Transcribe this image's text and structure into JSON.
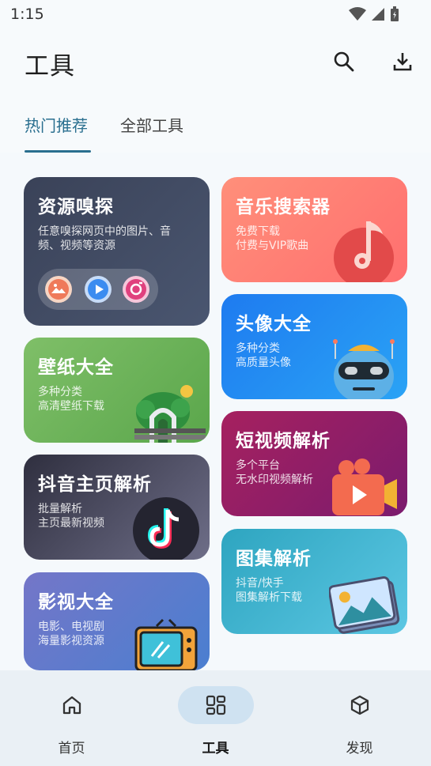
{
  "status": {
    "time": "1:15"
  },
  "header": {
    "title": "工具"
  },
  "tabs": [
    {
      "label": "热门推荐"
    },
    {
      "label": "全部工具"
    }
  ],
  "cards": {
    "sniff": {
      "title": "资源嗅探",
      "desc": [
        "任意嗅探网页中的图片、音",
        "频、视频等资源"
      ]
    },
    "music": {
      "title": "音乐搜索器",
      "desc": [
        "免费下载",
        "付费与VIP歌曲"
      ]
    },
    "avatar": {
      "title": "头像大全",
      "desc": [
        "多种分类",
        "高质量头像"
      ]
    },
    "wallpaper": {
      "title": "壁纸大全",
      "desc": [
        "多种分类",
        "高清壁纸下载"
      ]
    },
    "shortvideo": {
      "title": "短视频解析",
      "desc": [
        "多个平台",
        "无水印视频解析"
      ]
    },
    "douyin": {
      "title": "抖音主页解析",
      "desc": [
        "批量解析",
        "主页最新视频"
      ]
    },
    "gallery": {
      "title": "图集解析",
      "desc": [
        "抖音/快手",
        "图集解析下载"
      ]
    },
    "movies": {
      "title": "影视大全",
      "desc": [
        "电影、电视剧",
        "海量影视资源"
      ]
    }
  },
  "bottom_nav": [
    {
      "label": "首页",
      "icon": "home-icon"
    },
    {
      "label": "工具",
      "icon": "grid-icon"
    },
    {
      "label": "发现",
      "icon": "cube-icon"
    }
  ]
}
